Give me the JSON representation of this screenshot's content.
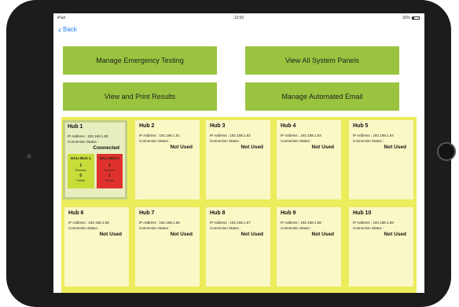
{
  "status_bar": {
    "carrier": "iPad",
    "time": "12:00",
    "battery": "30%"
  },
  "nav": {
    "back_label": "Back"
  },
  "actions": [
    {
      "label": "Manage Emergency Testing"
    },
    {
      "label": "View All System Panels"
    },
    {
      "label": "View and Print Results"
    },
    {
      "label": "Manage Automated Email"
    }
  ],
  "hubs": [
    {
      "title": "Hub 1",
      "ip": "IP Address : 192.168.1.50",
      "conn_label": "Connection Status :",
      "status": "Connected",
      "buses": [
        {
          "title": "DALI BUS 1",
          "devices": "1",
          "devices_label": "Devices",
          "faults": "0",
          "faults_label": "Faults",
          "state": "ok"
        },
        {
          "title": "DALI BUS 2",
          "devices": "2",
          "devices_label": "Devices",
          "faults": "1",
          "faults_label": "Faults",
          "state": "fault"
        }
      ]
    },
    {
      "title": "Hub 2",
      "ip": "IP Address : 192.168.1.51",
      "conn_label": "Connection Status :",
      "status": "Not Used"
    },
    {
      "title": "Hub 3",
      "ip": "IP Address : 192.168.1.52",
      "conn_label": "Connection Status :",
      "status": "Not Used"
    },
    {
      "title": "Hub 4",
      "ip": "IP Address : 192.168.1.53",
      "conn_label": "Connection Status :",
      "status": "Not Used"
    },
    {
      "title": "Hub 5",
      "ip": "IP Address : 192.168.1.54",
      "conn_label": "Connection Status :",
      "status": "Not Used"
    },
    {
      "title": "Hub 6",
      "ip": "IP Address : 192.168.1.55",
      "conn_label": "Connection Status :",
      "status": "Not Used"
    },
    {
      "title": "Hub 7",
      "ip": "IP Address : 192.168.1.56",
      "conn_label": "Connection Status :",
      "status": "Not Used"
    },
    {
      "title": "Hub 8",
      "ip": "IP Address : 192.168.1.57",
      "conn_label": "Connection Status :",
      "status": "Not Used"
    },
    {
      "title": "Hub 9",
      "ip": "IP Address : 192.168.1.58",
      "conn_label": "Connection Status :",
      "status": "Not Used"
    },
    {
      "title": "Hub 10",
      "ip": "IP Address : 192.168.1.59",
      "conn_label": "Connection Status :",
      "status": "Not Used"
    }
  ],
  "colors": {
    "accent_green": "#9ac43f",
    "panel_yellow": "#ecec5c",
    "tile": "#f9f8c6",
    "bus_ok": "#c8dd3a",
    "bus_fault": "#e0322c",
    "link_blue": "#1a7cf0"
  }
}
